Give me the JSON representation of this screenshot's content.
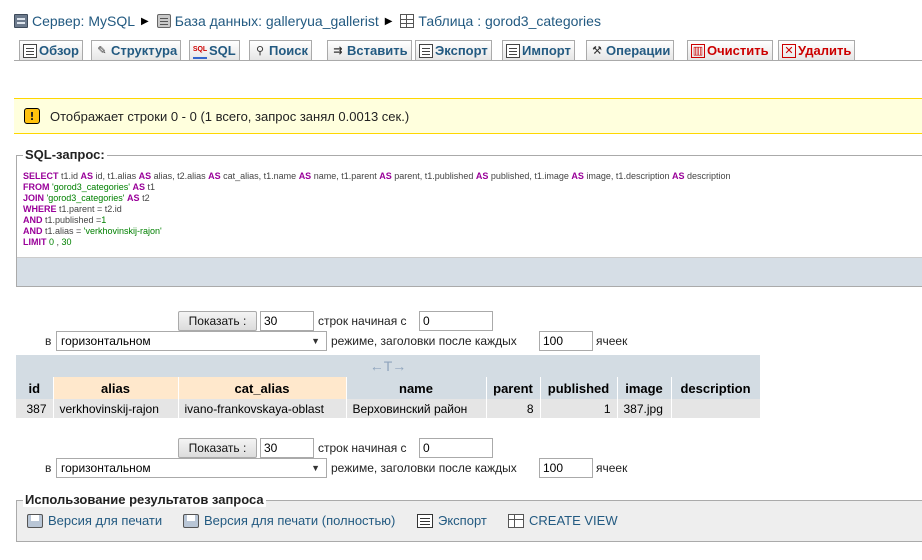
{
  "breadcrumbs": {
    "server": "Сервер: MySQL",
    "database": "База данных: galleryua_gallerist",
    "table": "Таблица : gorod3_categories"
  },
  "tabs": [
    {
      "label": "Обзор",
      "icon": "browse-icon"
    },
    {
      "label": "Структура",
      "icon": "structure-icon"
    },
    {
      "label": "SQL",
      "icon": "sql-icon"
    },
    {
      "label": "Поиск",
      "icon": "search-icon"
    },
    {
      "label": "Вставить",
      "icon": "insert-icon"
    },
    {
      "label": "Экспорт",
      "icon": "export-icon"
    },
    {
      "label": "Импорт",
      "icon": "import-icon"
    },
    {
      "label": "Операции",
      "icon": "operations-icon"
    },
    {
      "label": "Очистить",
      "icon": "empty-icon"
    },
    {
      "label": "Удалить",
      "icon": "drop-icon"
    }
  ],
  "notice": {
    "text": "Отображает строки 0 - 0 (1 всего, запрос занял 0.0013 сек.)"
  },
  "sql_query": {
    "legend": "SQL-запрос:",
    "lines": [
      "SELECT t1.id AS id, t1.alias AS alias, t2.alias AS cat_alias, t1.name AS name, t1.parent AS parent, t1.published AS published, t1.image AS image, t1.description AS description",
      "FROM 'gorod3_categories' AS t1",
      "JOIN 'gorod3_categories' AS t2",
      "WHERE t1.parent = t2.id",
      "AND t1.published =1",
      "AND t1.alias = 'verkhovinskij-rajon'",
      "LIMIT 0 , 30"
    ]
  },
  "navigation": {
    "show_button": "Показать :",
    "rows_value": "30",
    "start_label": "строк начиная с",
    "start_value": "0",
    "in_label": "в",
    "mode_value": "горизонтальном",
    "mode_label": "режиме, заголовки после каждых",
    "repeat_value": "100",
    "cells_label": "ячеек"
  },
  "results_table": {
    "toggle_label": "←T→",
    "columns": [
      "id",
      "alias",
      "cat_alias",
      "name",
      "parent",
      "published",
      "image",
      "description"
    ],
    "rows": [
      [
        "387",
        "verkhovinskij-rajon",
        "ivano-frankovskaya-oblast",
        "Верховинский район",
        "8",
        "1",
        "387.jpg",
        ""
      ]
    ]
  },
  "query_results_ops": {
    "legend": "Использование результатов запроса",
    "links": [
      "Версия для печати",
      "Версия для печати (полностью)",
      "Экспорт",
      "CREATE VIEW"
    ]
  }
}
